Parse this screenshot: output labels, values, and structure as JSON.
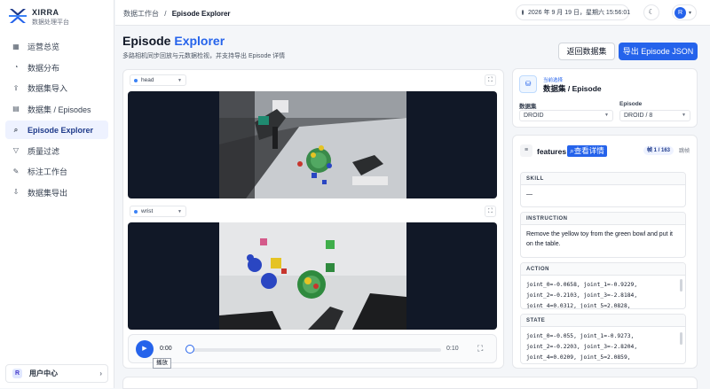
{
  "app": {
    "name": "XIRRA",
    "subtitle": "数据处理平台"
  },
  "nav": [
    {
      "label": "运营总览",
      "icon": "grid-icon"
    },
    {
      "label": "数据分布",
      "icon": "pie-icon"
    },
    {
      "label": "数据集导入",
      "icon": "upload-icon"
    },
    {
      "label": "数据集 / Episodes",
      "icon": "list-icon"
    },
    {
      "label": "Episode Explorer",
      "icon": "search-icon",
      "active": true
    },
    {
      "label": "质量过滤",
      "icon": "filter-icon"
    },
    {
      "label": "标注工作台",
      "icon": "pencil-icon"
    },
    {
      "label": "数据集导出",
      "icon": "download-icon"
    }
  ],
  "user": {
    "label": "用户中心",
    "avatar": "R"
  },
  "breadcrumb": {
    "parent": "数据工作台",
    "sep": "/",
    "current": "Episode Explorer"
  },
  "clock": "2026 年 9 月 19 日，星期六 15:56:01",
  "avatar_letter": "R",
  "page": {
    "title_a": "Episode ",
    "title_b": "Explorer",
    "subtitle": "多路相机同步回放与元数据检视，并支持导出 Episode 详情"
  },
  "buttons": {
    "back": "返回数据集",
    "export": "导出 Episode JSON"
  },
  "cameras": [
    {
      "name": "head"
    },
    {
      "name": "wrist"
    }
  ],
  "player": {
    "current": "0:00",
    "duration": "0:10",
    "tooltip": "播放"
  },
  "selection": {
    "small": "当前选择",
    "title": "数据集 / Episode",
    "dataset_label": "数据集",
    "dataset_value": "DROID",
    "episode_label": "Episode",
    "episode_value": "DROID / 8"
  },
  "features": {
    "title": "features",
    "link": "查看详情",
    "badge": "帧 1 / 163",
    "right": "跳帧",
    "skill_h": "SKILL",
    "skill_v": "—",
    "instr_h": "INSTRUCTION",
    "instr_v": "Remove the yellow toy from the green bowl and put it on the table.",
    "action_h": "ACTION",
    "action_l1": "joint_0=-0.0658, joint_1=-0.9229,",
    "action_l2": "joint_2=-0.2103, joint_3=-2.8184,",
    "action_l3": "joint_4=0.0312, joint_5=2.0828,",
    "state_h": "STATE",
    "state_l1": "joint_0=-0.055, joint_1=-0.9273,",
    "state_l2": "joint_2=-0.2203, joint_3=-2.8204,",
    "state_l3": "joint_4=0.0209, joint_5=2.0859,"
  }
}
